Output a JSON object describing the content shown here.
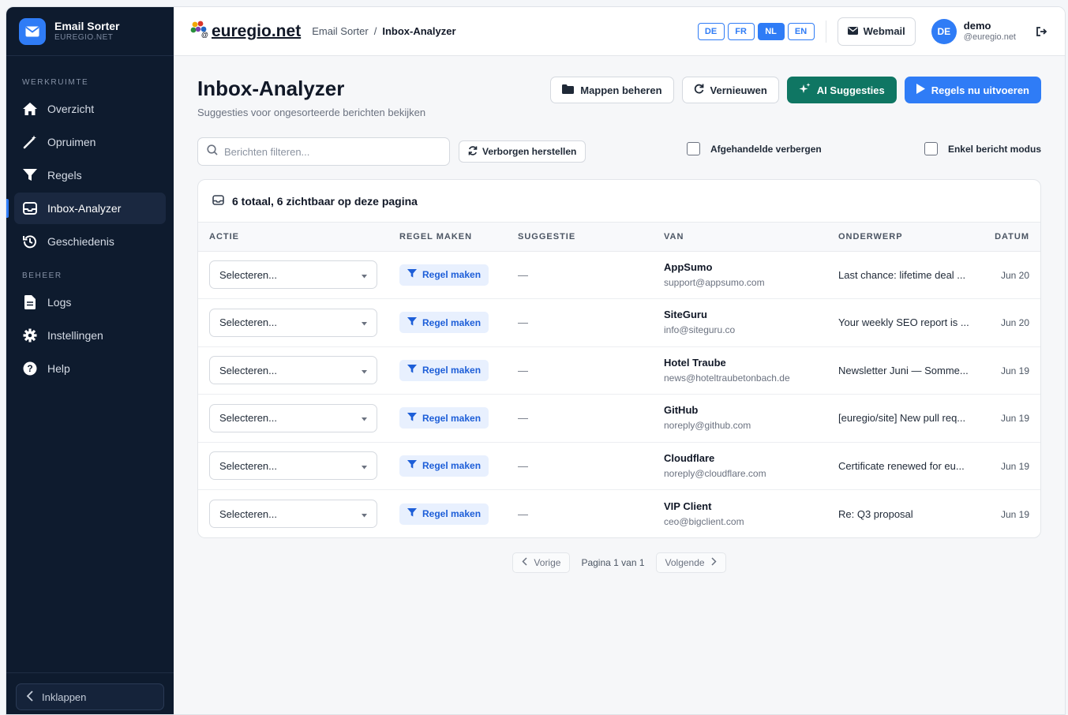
{
  "brand": {
    "title": "Email Sorter",
    "subtitle": "EUREGIO.NET"
  },
  "sidebar": {
    "section_workspace": "WERKRUIMTE",
    "section_admin": "BEHEER",
    "items": [
      {
        "label": "Overzicht",
        "icon": "home-icon"
      },
      {
        "label": "Opruimen",
        "icon": "magic-wand-icon"
      },
      {
        "label": "Regels",
        "icon": "filter-icon"
      },
      {
        "label": "Inbox-Analyzer",
        "icon": "inbox-icon",
        "active": true
      },
      {
        "label": "Geschiedenis",
        "icon": "history-icon"
      },
      {
        "label": "Logs",
        "icon": "file-icon"
      },
      {
        "label": "Instellingen",
        "icon": "gear-icon"
      },
      {
        "label": "Help",
        "icon": "help-icon"
      }
    ],
    "collapse_label": "Inklappen"
  },
  "topbar": {
    "logo_text": "euregio.net",
    "breadcrumb": [
      "Email Sorter",
      "/",
      "Inbox-Analyzer"
    ],
    "languages": [
      "DE",
      "FR",
      "NL",
      "EN"
    ],
    "active_language": "NL",
    "webmail_label": "Webmail",
    "user": {
      "initials": "DE",
      "name": "demo",
      "domain": "@euregio.net"
    }
  },
  "page": {
    "title": "Inbox-Analyzer",
    "subtitle": "Suggesties voor ongesorteerde berichten bekijken",
    "buttons": {
      "folders": "Mappen beheren",
      "refresh": "Vernieuwen",
      "ai": "AI Suggesties",
      "run": "Regels nu uitvoeren"
    }
  },
  "filters": {
    "search_placeholder": "Berichten filteren...",
    "restore_label": "Verborgen herstellen",
    "hide_done_label": "Afgehandelde verbergen",
    "single_mode_label": "Enkel bericht modus"
  },
  "table": {
    "summary": "6 totaal, 6 zichtbaar op deze pagina",
    "headers": [
      "ACTIE",
      "REGEL MAKEN",
      "SUGGESTIE",
      "VAN",
      "ONDERWERP",
      "DATUM"
    ],
    "select_placeholder": "Selecteren...",
    "rule_label": "Regel maken",
    "rows": [
      {
        "suggestion": "—",
        "from_name": "AppSumo",
        "from_email": "support@appsumo.com",
        "subject": "Last chance: lifetime deal ...",
        "date": "Jun 20"
      },
      {
        "suggestion": "—",
        "from_name": "SiteGuru",
        "from_email": "info@siteguru.co",
        "subject": "Your weekly SEO report is ...",
        "date": "Jun 20"
      },
      {
        "suggestion": "—",
        "from_name": "Hotel Traube",
        "from_email": "news@hoteltraubetonbach.de",
        "subject": "Newsletter Juni — Somme...",
        "date": "Jun 19"
      },
      {
        "suggestion": "—",
        "from_name": "GitHub",
        "from_email": "noreply@github.com",
        "subject": "[euregio/site] New pull req...",
        "date": "Jun 19"
      },
      {
        "suggestion": "—",
        "from_name": "Cloudflare",
        "from_email": "noreply@cloudflare.com",
        "subject": "Certificate renewed for eu...",
        "date": "Jun 19"
      },
      {
        "suggestion": "—",
        "from_name": "VIP Client",
        "from_email": "ceo@bigclient.com",
        "subject": "Re: Q3 proposal",
        "date": "Jun 19"
      }
    ]
  },
  "pagination": {
    "prev": "Vorige",
    "info": "Pagina 1 van 1",
    "next": "Volgende"
  },
  "colors": {
    "accent": "#2f7cf6",
    "sidebar_bg": "#0e1b2e",
    "ai_green": "#0f7663"
  }
}
